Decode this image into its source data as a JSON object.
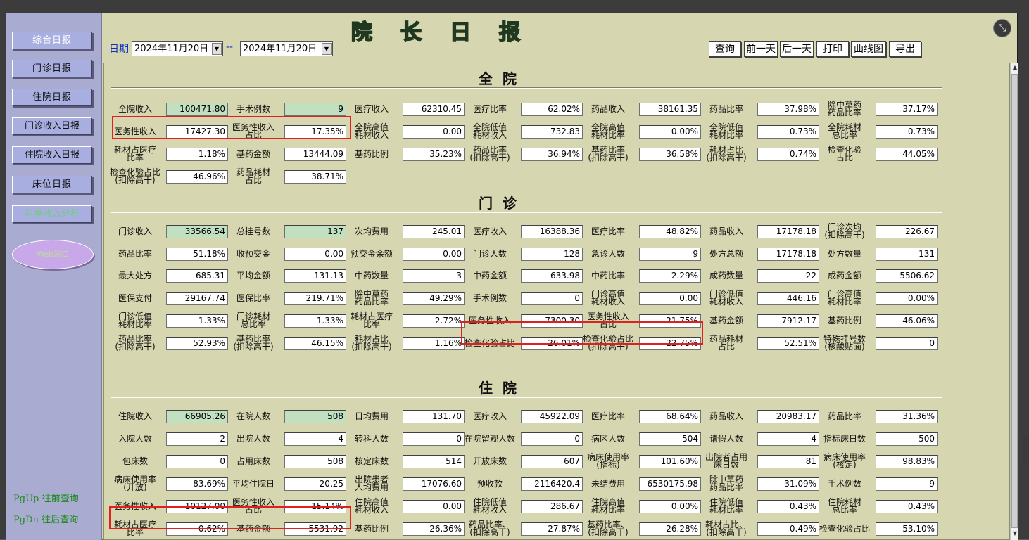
{
  "window": {
    "title": "院长日报",
    "close_icon": "fullscreen-exit-icon"
  },
  "sidebar": {
    "items": [
      {
        "label": "综合日报"
      },
      {
        "label": "门诊日报"
      },
      {
        "label": "住院日报"
      },
      {
        "label": "门诊收入日报"
      },
      {
        "label": "住院收入日报"
      },
      {
        "label": "床位日报"
      },
      {
        "label": "科室收入分析"
      },
      {
        "label": "Web端口"
      }
    ],
    "hints": [
      "PgUp-往前查询",
      "PgDn-往后查询"
    ]
  },
  "toolbar": {
    "date_label": "日期",
    "date_from": "2024年11月20日",
    "date_sep": "--",
    "date_to": "2024年11月20日",
    "buttons": [
      "查询",
      "前一天",
      "后一天",
      "打印",
      "曲线图",
      "导出"
    ]
  },
  "sections": [
    {
      "title": "全院",
      "rows": [
        [
          [
            "全院收入",
            "100471.80",
            1
          ],
          [
            "手术例数",
            "9",
            1
          ],
          [
            "医疗收入",
            "62310.45",
            0
          ],
          [
            "医疗比率",
            "62.02%",
            0
          ],
          [
            "药品收入",
            "38161.35",
            0
          ],
          [
            "药品比率",
            "37.98%",
            0
          ],
          [
            "除中草药\n药品比率",
            "37.17%",
            0
          ]
        ],
        [
          [
            "医务性收入",
            "17427.30",
            0
          ],
          [
            "医务性收入\n占比",
            "17.35%",
            0
          ],
          [
            "全院高值\n耗材收入",
            "0.00",
            0
          ],
          [
            "全院低值\n耗材收入",
            "732.83",
            0
          ],
          [
            "全院高值\n耗材比率",
            "0.00%",
            0
          ],
          [
            "全院低值\n耗材比率",
            "0.73%",
            0
          ],
          [
            "全院耗材\n总比率",
            "0.73%",
            0
          ]
        ],
        [
          [
            "耗材占医疗\n比率",
            "1.18%",
            0
          ],
          [
            "基药金额",
            "13444.09",
            0
          ],
          [
            "基药比例",
            "35.23%",
            0
          ],
          [
            "药品比率\n(扣除高干)",
            "36.94%",
            0
          ],
          [
            "基药比率\n(扣除高干)",
            "36.58%",
            0
          ],
          [
            "耗材占比\n(扣除高干)",
            "0.74%",
            0
          ],
          [
            "检查化验\n占比",
            "44.05%",
            0
          ]
        ],
        [
          [
            "检查化验占比\n(扣除高干)",
            "46.96%",
            0
          ],
          [
            "药品耗材\n占比",
            "38.71%",
            0
          ]
        ]
      ]
    },
    {
      "title": "门诊",
      "rows": [
        [
          [
            "门诊收入",
            "33566.54",
            2
          ],
          [
            "总挂号数",
            "137",
            2
          ],
          [
            "次均费用",
            "245.01",
            0
          ],
          [
            "医疗收入",
            "16388.36",
            0
          ],
          [
            "医疗比率",
            "48.82%",
            0
          ],
          [
            "药品收入",
            "17178.18",
            0
          ],
          [
            "门诊次均\n(扣除高干)",
            "226.67",
            0
          ]
        ],
        [
          [
            "药品比率",
            "51.18%",
            0
          ],
          [
            "收预交金",
            "0.00",
            0
          ],
          [
            "预交金余额",
            "0.00",
            0
          ],
          [
            "门诊人数",
            "128",
            0
          ],
          [
            "急诊人数",
            "9",
            0
          ],
          [
            "处方总额",
            "17178.18",
            0
          ],
          [
            "处方数量",
            "131",
            0
          ]
        ],
        [
          [
            "最大处方",
            "685.31",
            0
          ],
          [
            "平均金额",
            "131.13",
            0
          ],
          [
            "中药数量",
            "3",
            0
          ],
          [
            "中药金额",
            "633.98",
            0
          ],
          [
            "中药比率",
            "2.29%",
            0
          ],
          [
            "成药数量",
            "22",
            0
          ],
          [
            "成药金额",
            "5506.62",
            0
          ]
        ],
        [
          [
            "医保支付",
            "29167.74",
            0
          ],
          [
            "医保比率",
            "219.71%",
            0
          ],
          [
            "除中草药\n药品比率",
            "49.29%",
            0
          ],
          [
            "手术例数",
            "0",
            0
          ],
          [
            "门诊高值\n耗材收入",
            "0.00",
            0
          ],
          [
            "门诊低值\n耗材收入",
            "446.16",
            0
          ],
          [
            "门诊高值\n耗材比率",
            "0.00%",
            0
          ]
        ],
        [
          [
            "门诊低值\n耗材比率",
            "1.33%",
            0
          ],
          [
            "门诊耗材\n总比率",
            "1.33%",
            0
          ],
          [
            "耗材占医疗\n比率",
            "2.72%",
            0
          ],
          [
            "医务性收入",
            "7300.30",
            0
          ],
          [
            "医务性收入\n占比",
            "21.75%",
            0
          ],
          [
            "基药金额",
            "7912.17",
            0
          ],
          [
            "基药比例",
            "46.06%",
            0
          ]
        ],
        [
          [
            "药品比率\n(扣除高干)",
            "52.93%",
            0
          ],
          [
            "基药比率\n(扣除高干)",
            "46.15%",
            0
          ],
          [
            "耗材占比\n(扣除高干)",
            "1.16%",
            0
          ],
          [
            "检查化验占比",
            "26.01%",
            0
          ],
          [
            "检查化验占比\n(扣除高干)",
            "22.75%",
            0
          ],
          [
            "药品耗材\n占比",
            "52.51%",
            0
          ],
          [
            "特殊挂号数\n(核酸贴面)",
            "0",
            0
          ]
        ]
      ]
    },
    {
      "title": "住院",
      "rows": [
        [
          [
            "住院收入",
            "66905.26",
            2
          ],
          [
            "在院人数",
            "508",
            2
          ],
          [
            "日均费用",
            "131.70",
            0
          ],
          [
            "医疗收入",
            "45922.09",
            0
          ],
          [
            "医疗比率",
            "68.64%",
            0
          ],
          [
            "药品收入",
            "20983.17",
            0
          ],
          [
            "药品比率",
            "31.36%",
            0
          ]
        ],
        [
          [
            "入院人数",
            "2",
            0
          ],
          [
            "出院人数",
            "4",
            0
          ],
          [
            "转科人数",
            "0",
            0
          ],
          [
            "在院留观人数",
            "0",
            0
          ],
          [
            "病区人数",
            "504",
            0
          ],
          [
            "请假人数",
            "4",
            0
          ],
          [
            "指标床日数",
            "500",
            0
          ]
        ],
        [
          [
            "包床数",
            "0",
            0
          ],
          [
            "占用床数",
            "508",
            0
          ],
          [
            "核定床数",
            "514",
            0
          ],
          [
            "开放床数",
            "607",
            0
          ],
          [
            "病床使用率\n(指标)",
            "101.60%",
            0
          ],
          [
            "出院者占用\n床日数",
            "81",
            0
          ],
          [
            "病床使用率\n(核定)",
            "98.83%",
            0
          ]
        ],
        [
          [
            "病床使用率\n(开放)",
            "83.69%",
            0
          ],
          [
            "平均住院日",
            "20.25",
            0
          ],
          [
            "出院患者\n人均费用",
            "17076.60",
            0
          ],
          [
            "预收款",
            "2116420.4",
            0
          ],
          [
            "未结费用",
            "6530175.98",
            0
          ],
          [
            "除中草药\n药品比率",
            "31.09%",
            0
          ],
          [
            "手术例数",
            "9",
            0
          ]
        ],
        [
          [
            "医务性收入",
            "10127.00",
            0
          ],
          [
            "医务性收入\n占比",
            "15.14%",
            0
          ],
          [
            "住院高值\n耗材收入",
            "0.00",
            0
          ],
          [
            "住院低值\n耗材收入",
            "286.67",
            0
          ],
          [
            "住院高值\n耗材比率",
            "0.00%",
            0
          ],
          [
            "住院低值\n耗材比率",
            "0.43%",
            0
          ],
          [
            "住院耗材\n总比率",
            "0.43%",
            0
          ]
        ],
        [
          [
            "耗材占医疗\n比率",
            "0.62%",
            0
          ],
          [
            "基药金额",
            "5531.92",
            0
          ],
          [
            "基药比例",
            "26.36%",
            0
          ],
          [
            "药品比率、\n(扣除高干)",
            "27.87%",
            0
          ],
          [
            "基药比率、\n(扣除高干)",
            "26.28%",
            0
          ],
          [
            "耗材占比、\n(扣除高干)",
            "0.49%",
            0
          ],
          [
            "检查化验占比",
            "53.10%",
            0
          ]
        ]
      ]
    }
  ],
  "colors": {
    "highlight_box": "#e02020",
    "highlight_cell": "#c0e0c0",
    "panel_bg": "#d6d6b0"
  }
}
